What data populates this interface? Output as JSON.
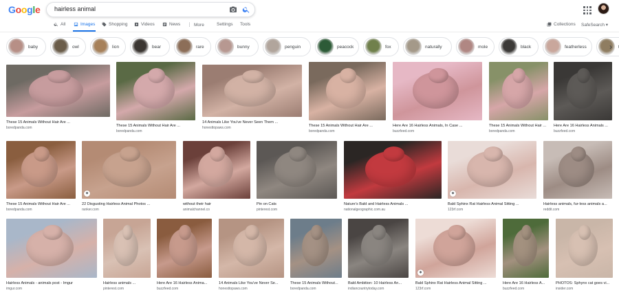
{
  "logo": {
    "letters": [
      "G",
      "o",
      "o",
      "g",
      "l",
      "e"
    ],
    "colors": [
      "#4285f4",
      "#ea4335",
      "#fbbc05",
      "#4285f4",
      "#34a853",
      "#ea4335"
    ]
  },
  "search": {
    "query": "hairless animal"
  },
  "tabs": {
    "all": "All",
    "images": "Images",
    "shopping": "Shopping",
    "videos": "Videos",
    "news": "News",
    "more": "More",
    "settings": "Settings",
    "tools": "Tools",
    "collections": "Collections",
    "safesearch": "SafeSearch ▾"
  },
  "chips": [
    "baby",
    "owl",
    "lion",
    "bear",
    "rare",
    "bunny",
    "penguin",
    "peacock",
    "fox",
    "naturally",
    "mole",
    "black",
    "featherless",
    "tiger"
  ],
  "chip_colors": [
    "#b78f86",
    "#6b5d4a",
    "#a7815a",
    "#3b3632",
    "#8c6e58",
    "#b79891",
    "#b1a59c",
    "#2d5b37",
    "#70804c",
    "#a49989",
    "#b08783",
    "#3c3a38",
    "#c9a79c",
    "#8f7d61"
  ],
  "results": [
    {
      "title": "These 15 Animals Without Hair Are ...",
      "source": "boredpanda.com",
      "color": "#c79c9e",
      "color2": "#6e6a63"
    },
    {
      "title": "These 15 Animals Without Hair Are ...",
      "source": "boredpanda.com",
      "color": "#d4a9ab",
      "color2": "#5a6a45"
    },
    {
      "title": "14 Animals Like You've Never Seen Them ...",
      "source": "honesttopaws.com",
      "color": "#d2b2a5",
      "color2": "#9b7d72"
    },
    {
      "title": "These 15 Animals Without Hair Are ...",
      "source": "boredpanda.com",
      "color": "#d8b2a3",
      "color2": "#7a6a5d"
    },
    {
      "title": "Here Are 16 Hairless Animals, In Case ...",
      "source": "buzzfeed.com",
      "color": "#cf959b",
      "color2": "#e6b8c5"
    },
    {
      "title": "These 15 Animals Without Hair Are ...",
      "source": "boredpanda.com",
      "color": "#d6a6a8",
      "color2": "#879168"
    },
    {
      "title": "Here Are 16 Hairless Animals ...",
      "source": "buzzfeed.com",
      "color": "#5d5a57",
      "color2": "#3a3836"
    },
    {
      "title": "These 15 Animals Without Hair Are ...",
      "source": "boredpanda.com",
      "color": "#c99a88",
      "color2": "#8a5e3f"
    },
    {
      "title": "22 Disgusting Hairless Animal Photos ...",
      "source": "ranker.com",
      "color": "#c7a28e",
      "color2": "#b48b74"
    },
    {
      "title": "without their hair",
      "source": "animalchannel.co",
      "color": "#d3a89f",
      "color2": "#6b403a"
    },
    {
      "title": "Pin on Cats",
      "source": "pinterest.com",
      "color": "#8f8780",
      "color2": "#5c5855"
    },
    {
      "title": "Nature's Bald and Hairless Animals ...",
      "source": "nationalgeographic.com.au",
      "color": "#c23a3f",
      "color2": "#2b2624"
    },
    {
      "title": "Bald Sphinx Rat Hairless Animal Sitting ...",
      "source": "123rf.com",
      "color": "#d8b6ad",
      "color2": "#e9dcd8"
    },
    {
      "title": "Hairless animals, fur-less animals a...",
      "source": "reddit.com",
      "color": "#9d8c84",
      "color2": "#c7bcb6"
    },
    {
      "title": "Hairless Animals - animals post - Imgur",
      "source": "imgur.com",
      "color": "#d6b1a9",
      "color2": "#a9b7c9"
    },
    {
      "title": "Hairless animals ...",
      "source": "pinterest.com",
      "color": "#d9c1b4",
      "color2": "#c7a595"
    },
    {
      "title": "Here Are 16 Hairless Anima...",
      "source": "buzzfeed.com",
      "color": "#c79a8c",
      "color2": "#8a5c3f"
    },
    {
      "title": "14 Animals Like You've Never Se...",
      "source": "honesttopaws.com",
      "color": "#d4b7a8",
      "color2": "#b59483"
    },
    {
      "title": "These 15 Animals Without...",
      "source": "boredpanda.com",
      "color": "#a49184",
      "color2": "#6d7d8a"
    },
    {
      "title": "Bald Ambition: 10 Hairless An...",
      "source": "indiancountrytoday.com",
      "color": "#8a8580",
      "color2": "#4a4543"
    },
    {
      "title": "Bald Sphinx Rat Hairless Animal Sitting ...",
      "source": "123rf.com",
      "color": "#d0a49a",
      "color2": "#eddcd6"
    },
    {
      "title": "Here Are 16 Hairless A...",
      "source": "buzzfeed.com",
      "color": "#a3917f",
      "color2": "#4e6b3a"
    },
    {
      "title": "PHOTOS: Sphynx cat goes vi...",
      "source": "insider.com",
      "color": "#d7c0b2",
      "color2": "#c9b6a8"
    }
  ]
}
